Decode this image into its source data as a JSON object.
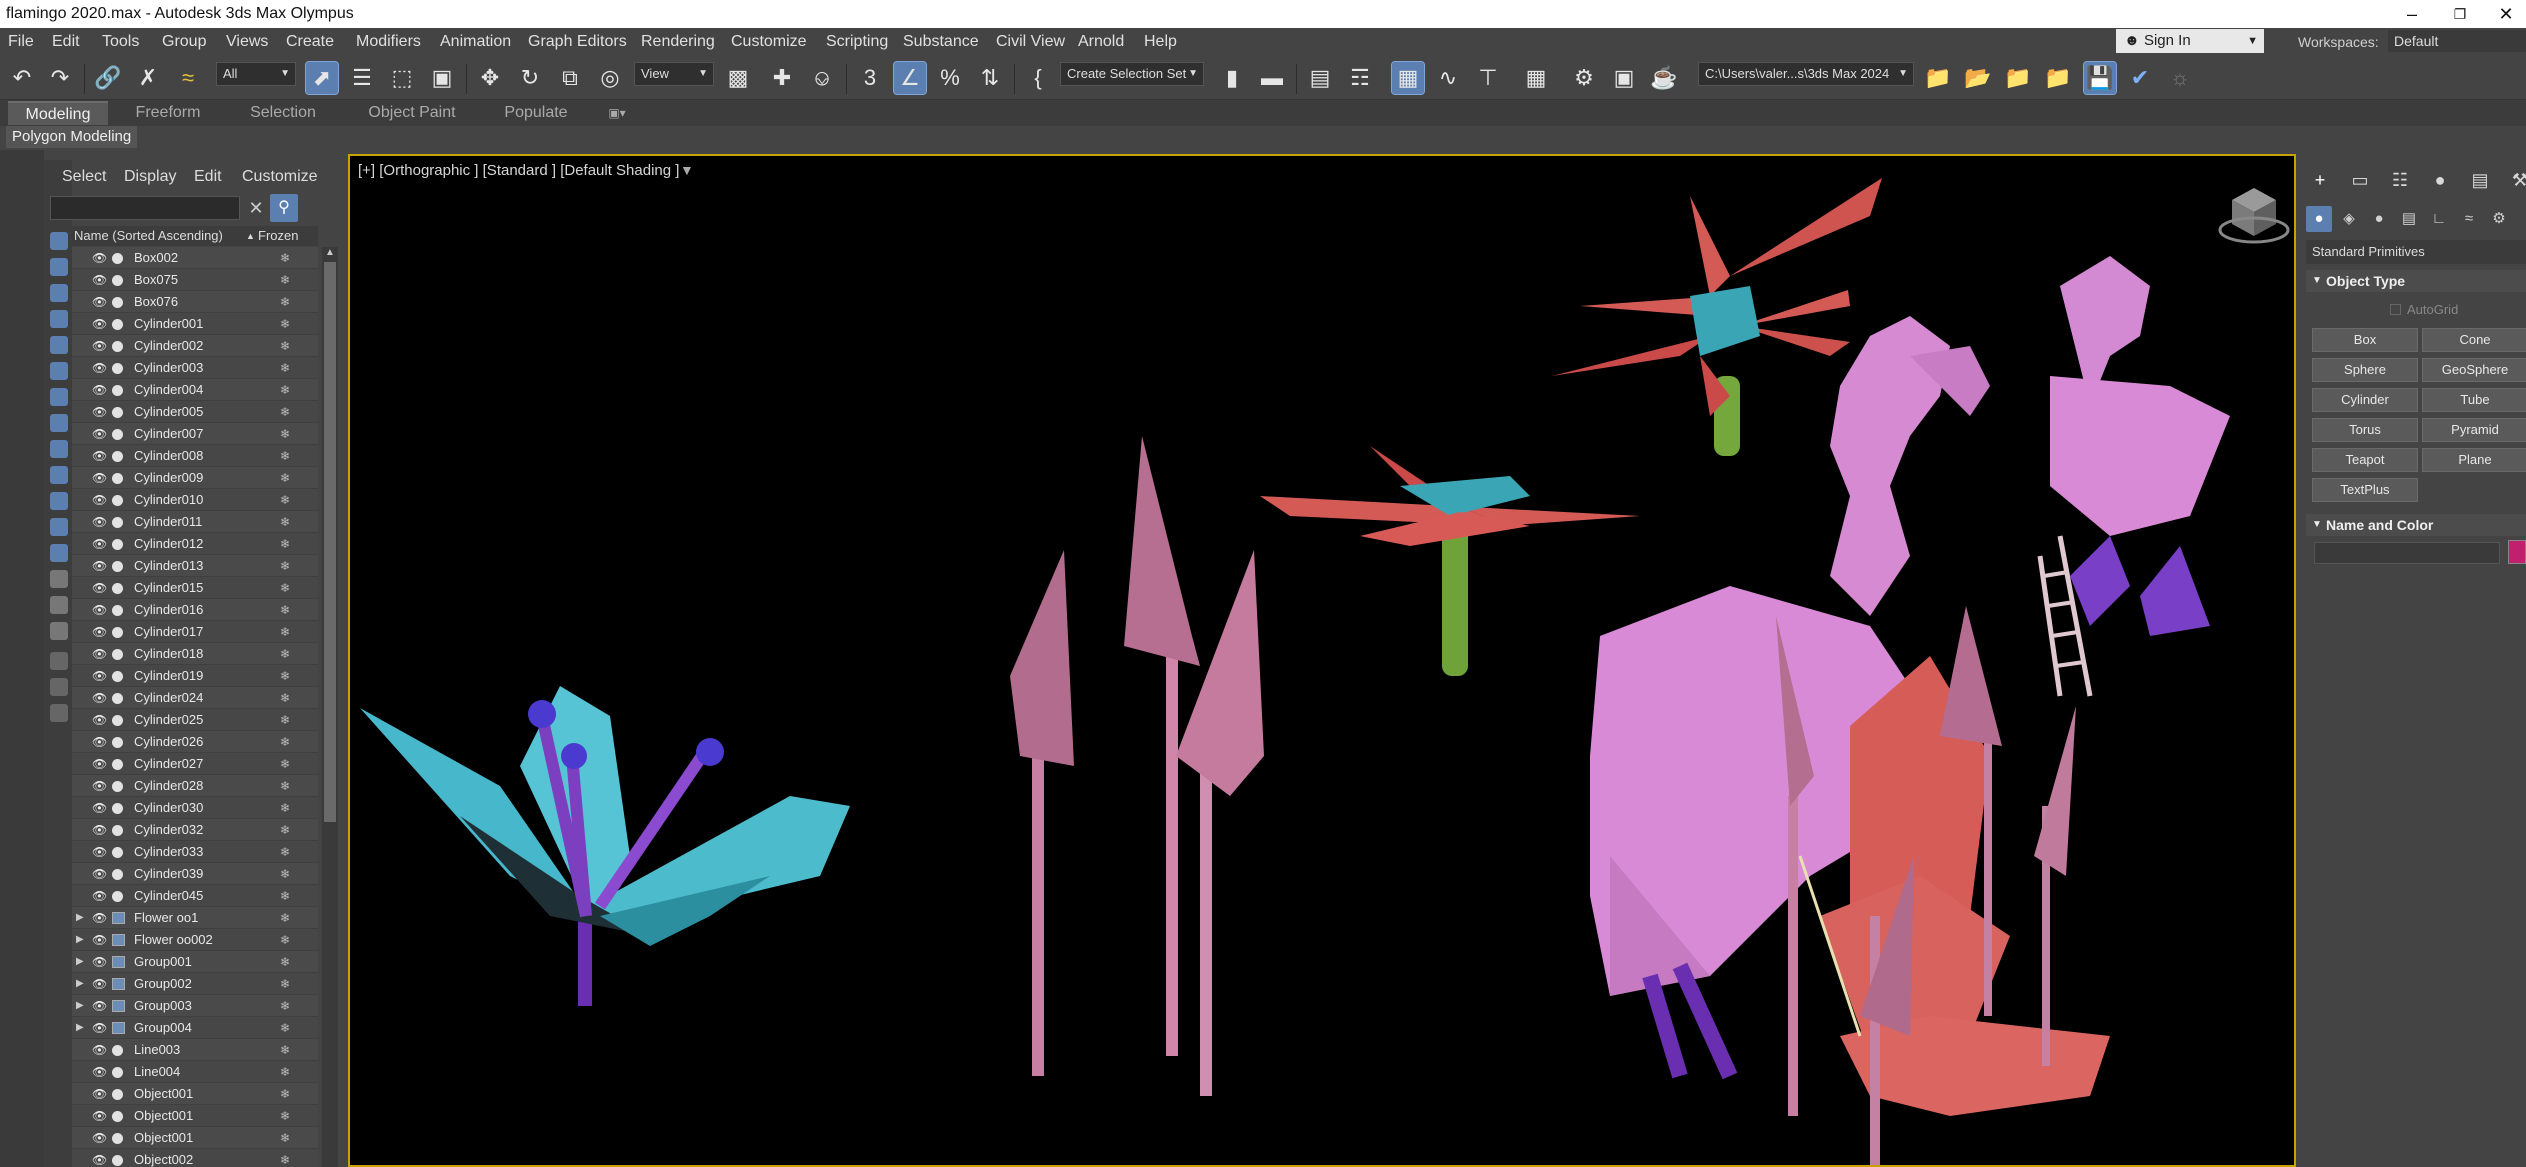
{
  "window": {
    "title": "flamingo 2020.max - Autodesk 3ds Max Olympus"
  },
  "menu": [
    "File",
    "Edit",
    "Tools",
    "Group",
    "Views",
    "Create",
    "Modifiers",
    "Animation",
    "Graph Editors",
    "Rendering",
    "Customize",
    "Scripting",
    "Substance",
    "Civil View",
    "Arnold",
    "Help"
  ],
  "account": {
    "sign_in": "Sign In",
    "workspaces_label": "Workspaces:",
    "workspace": "Default"
  },
  "toolbar": {
    "selection_filter": "All",
    "reference_coord": "View",
    "named_selection": "Create Selection Set",
    "project_path": "C:\\Users\\valer...s\\3ds Max 2024"
  },
  "ribbon": {
    "tabs": [
      "Modeling",
      "Freeform",
      "Selection",
      "Object Paint",
      "Populate"
    ],
    "sub_tab": "Polygon Modeling"
  },
  "explorer": {
    "menu": [
      "Select",
      "Display",
      "Edit",
      "Customize"
    ],
    "col_name": "Name (Sorted Ascending)",
    "col_frozen": "Frozen",
    "sort_arrow": "▲",
    "items": [
      {
        "name": "Box002",
        "group": false
      },
      {
        "name": "Box075",
        "group": false
      },
      {
        "name": "Box076",
        "group": false
      },
      {
        "name": "Cylinder001",
        "group": false
      },
      {
        "name": "Cylinder002",
        "group": false
      },
      {
        "name": "Cylinder003",
        "group": false
      },
      {
        "name": "Cylinder004",
        "group": false
      },
      {
        "name": "Cylinder005",
        "group": false
      },
      {
        "name": "Cylinder007",
        "group": false
      },
      {
        "name": "Cylinder008",
        "group": false
      },
      {
        "name": "Cylinder009",
        "group": false
      },
      {
        "name": "Cylinder010",
        "group": false
      },
      {
        "name": "Cylinder011",
        "group": false
      },
      {
        "name": "Cylinder012",
        "group": false
      },
      {
        "name": "Cylinder013",
        "group": false
      },
      {
        "name": "Cylinder015",
        "group": false
      },
      {
        "name": "Cylinder016",
        "group": false
      },
      {
        "name": "Cylinder017",
        "group": false
      },
      {
        "name": "Cylinder018",
        "group": false
      },
      {
        "name": "Cylinder019",
        "group": false
      },
      {
        "name": "Cylinder024",
        "group": false
      },
      {
        "name": "Cylinder025",
        "group": false
      },
      {
        "name": "Cylinder026",
        "group": false
      },
      {
        "name": "Cylinder027",
        "group": false
      },
      {
        "name": "Cylinder028",
        "group": false
      },
      {
        "name": "Cylinder030",
        "group": false
      },
      {
        "name": "Cylinder032",
        "group": false
      },
      {
        "name": "Cylinder033",
        "group": false
      },
      {
        "name": "Cylinder039",
        "group": false
      },
      {
        "name": "Cylinder045",
        "group": false
      },
      {
        "name": "Flower oo1",
        "group": true
      },
      {
        "name": "Flower oo002",
        "group": true
      },
      {
        "name": "Group001",
        "group": true
      },
      {
        "name": "Group002",
        "group": true
      },
      {
        "name": "Group003",
        "group": true
      },
      {
        "name": "Group004",
        "group": true
      },
      {
        "name": "Line003",
        "group": false
      },
      {
        "name": "Line004",
        "group": false
      },
      {
        "name": "Object001",
        "group": false
      },
      {
        "name": "Object001",
        "group": false
      },
      {
        "name": "Object001",
        "group": false
      },
      {
        "name": "Object002",
        "group": false
      }
    ]
  },
  "viewport": {
    "label": "[+] [Orthographic ] [Standard ] [Default Shading ]"
  },
  "command_panel": {
    "category": "Standard Primitives",
    "object_type": "Object Type",
    "autogrid": "AutoGrid",
    "buttons": [
      "Box",
      "Cone",
      "Sphere",
      "GeoSphere",
      "Cylinder",
      "Tube",
      "Torus",
      "Pyramid",
      "Teapot",
      "Plane",
      "TextPlus"
    ],
    "name_and_color": "Name and Color",
    "color": "#c1206e"
  },
  "colors": {
    "viewport_border": "#c9a100",
    "active_blue": "#5b7fb0",
    "flamingo_pink": "#d98ad6",
    "leaf_red": "#d45a55",
    "petal_cyan": "#4fc3d2",
    "stem_purple": "#7b3fbf"
  }
}
